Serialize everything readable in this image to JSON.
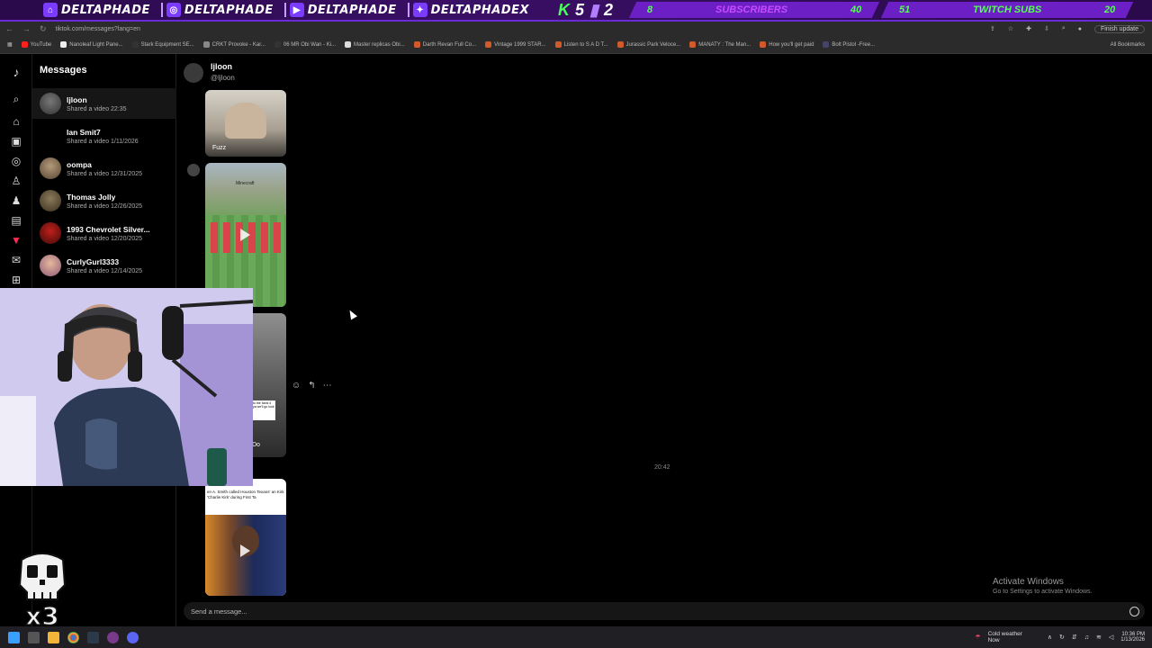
{
  "overlay": {
    "handles": [
      {
        "icon": "twitch-icon",
        "name": "DELTAPHADE"
      },
      {
        "icon": "instagram-icon",
        "name": "DELTAPHADE"
      },
      {
        "icon": "youtube-icon",
        "name": "DELTAPHADE"
      },
      {
        "icon": "twitter-icon",
        "name": "DELTAPHADEX"
      }
    ],
    "kick_count": "5",
    "twitch_count": "2",
    "subscribers": {
      "current": "8",
      "label": "SUBSCRIBERS",
      "goal": "40"
    },
    "twitch_subs": {
      "current": "51",
      "label": "TWITCH SUBS",
      "goal": "20"
    }
  },
  "browser": {
    "url": "tiktok.com/messages?lang=en",
    "update_label": "Finish update",
    "all_bookmarks": "All Bookmarks",
    "bookmarks": [
      "YouTube",
      "Nanoleaf Light Pane...",
      "Stark Equipment SE...",
      "CRKT Provoke - Kar...",
      "06 MR Obi Wan - Ki...",
      "Master replicas Obi...",
      "Darth Revan Full Co...",
      "Vintage 1999 STAR...",
      "Listen to S A D T...",
      "Jurassic Park Veloce...",
      "MANATY : The Man...",
      "How you'll get paid",
      "Bolt Pistol -Free..."
    ]
  },
  "messages": {
    "title": "Messages",
    "conversations": [
      {
        "name": "ljloon",
        "subtitle": "Shared a video 22:35"
      },
      {
        "name": "Ian Smit7",
        "subtitle": "Shared a video 1/11/2026"
      },
      {
        "name": "oompa",
        "subtitle": "Shared a video 12/31/2025"
      },
      {
        "name": "Thomas Jolly",
        "subtitle": "Shared a video 12/26/2025"
      },
      {
        "name": "1993 Chevrolet Silver...",
        "subtitle": "Shared a video 12/20/2025"
      },
      {
        "name": "CurlyGurl3333",
        "subtitle": "Shared a video 12/14/2025"
      }
    ]
  },
  "chat": {
    "name": "ljloon",
    "handle": "@ljloon",
    "video1_label": "Fuzz",
    "video2_top_label": "Minecraft",
    "video3_caption": "to the bank 4 ya we'll go look",
    "video3_bottom": "Do",
    "video4_headline": "en A. Smith called Houston Texans' an Kirk 'Charlie Kirk' during First Ta",
    "timestamp": "20:42",
    "input_placeholder": "Send a message..."
  },
  "activation": {
    "title": "Activate Windows",
    "subtitle": "Go to Settings to activate Windows."
  },
  "overlay_extra": {
    "multiplier": "x3"
  },
  "taskbar": {
    "weather_title": "Cold weather",
    "weather_sub": "Now",
    "time": "10:36 PM",
    "date": "1/13/2026"
  },
  "colors": {
    "overlay_bg": "#3a0f66",
    "overlay_accent": "#6a2bd6",
    "stat_green": "#53ff53",
    "tiktok_red": "#fe2c55"
  }
}
